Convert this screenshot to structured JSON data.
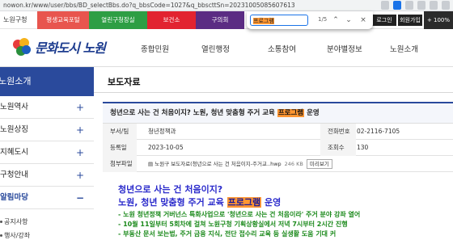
{
  "browser": {
    "url": "nowon.kr/www/user/bbs/BD_selectBbs.do?q_bbsCode=1027&q_bbscttSn=20231005085607613"
  },
  "find": {
    "query": "프로그램",
    "count": "1/5"
  },
  "topbar": {
    "home": "노원구청",
    "tabs": [
      {
        "label": "평생교육포털",
        "color": "#e8554e"
      },
      {
        "label": "열린구청장실",
        "color": "#2e9e44"
      },
      {
        "label": "보건소",
        "color": "#e22330"
      },
      {
        "label": "구의회",
        "color": "#5b2c83"
      }
    ],
    "login": "로그인",
    "join": "회원가입",
    "zoom": "+ 100% −"
  },
  "header": {
    "logo_text": "문화도시 노원",
    "nav": [
      "종합민원",
      "열린행정",
      "소통참여",
      "분야별정보",
      "노원소개"
    ]
  },
  "sidebar": {
    "title": "노원소개",
    "items": [
      {
        "label": "노원역사",
        "icon": "+"
      },
      {
        "label": "노원상징",
        "icon": "+"
      },
      {
        "label": "지혜도시",
        "icon": "+"
      },
      {
        "label": "구청안내",
        "icon": "+"
      },
      {
        "label": "알림마당",
        "icon": "−"
      }
    ],
    "sub_items": [
      "공지사항",
      "행사/강좌"
    ]
  },
  "content": {
    "page_title": "보도자료",
    "subject_before": "청년으로 사는 건 처음이지? 노원, 청년 맞춤형 주거 교육 ",
    "subject_highlight": "프로그램",
    "subject_after": " 운영",
    "meta": {
      "dept_label": "부서/팀",
      "dept_value": "청년정책과",
      "phone_label": "전화번호",
      "phone_value": "02-2116-7105",
      "date_label": "등록일",
      "date_value": "2023-10-05",
      "views_label": "조회수",
      "views_value": "130",
      "attach_label": "첨부파일",
      "attach_name": "노원구 보도자료(청년으로 사는 건 처음이지-주거교..hwp",
      "attach_size": "246 KB",
      "preview_label": "미리보기"
    },
    "body": {
      "line1": "청년으로 사는 건 처음이지?",
      "line2_before": "노원, 청년 맞춤형 주거 교육 ",
      "line2_highlight": "프로그램",
      "line2_after": " 운영",
      "bullets": [
        "- 노원 청년정책 거버넌스 특화사업으로 '청년으로 사는 건 처음이라' 주거 분야 강좌 열어",
        "- 10월 11일부터 5회차에 걸쳐 노원구청 기획상황실에서 저녁 7시부터 2시간 진행",
        "- 부동산 문서 보는법, 주거 금융 지식, 전단 접수리 교육 등 실생활 도움 기대 커"
      ]
    }
  }
}
